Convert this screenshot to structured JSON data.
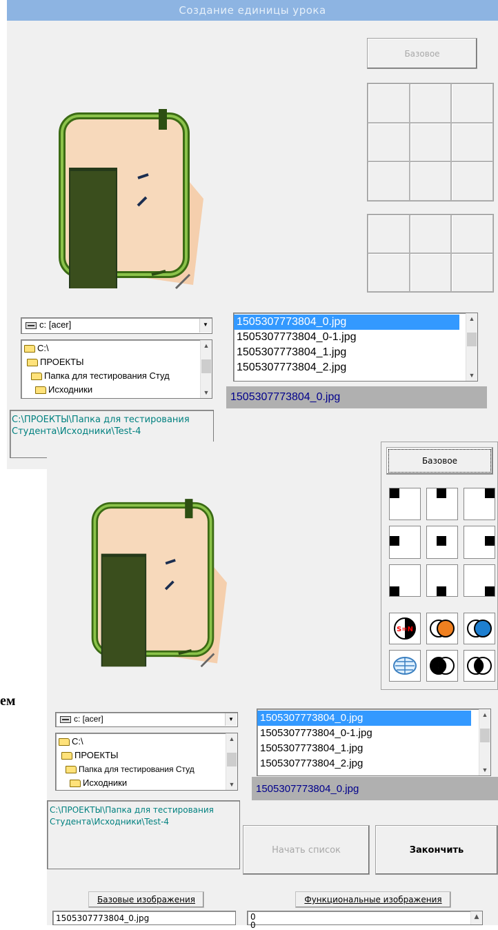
{
  "window_title": "Создание единицы урока",
  "base_button": "Базовое",
  "drive": "c: [acer]",
  "tree": [
    "C:\\",
    "ПРОЕКТЫ",
    "Папка для тестирования Студ",
    "Исходники"
  ],
  "files": [
    "1505307773804_0.jpg",
    "1505307773804_0-1.jpg",
    "1505307773804_1.jpg",
    "1505307773804_2.jpg"
  ],
  "selected_file": "1505307773804_0.jpg",
  "path_line1": "C:\\ПРОЕКТЫ\\Папка для тестирования",
  "path_line2": "Студента\\Исходники\\Test-4",
  "start_list": "Начать список",
  "finish": "Закончить",
  "tab_base": "Базовые изображения",
  "tab_func": "Функциональные изображения",
  "base_list": [
    "1505307773804_0.jpg"
  ],
  "func_list": [
    "0",
    "0"
  ],
  "fragment": "ем",
  "func_icon_label": "S=N"
}
